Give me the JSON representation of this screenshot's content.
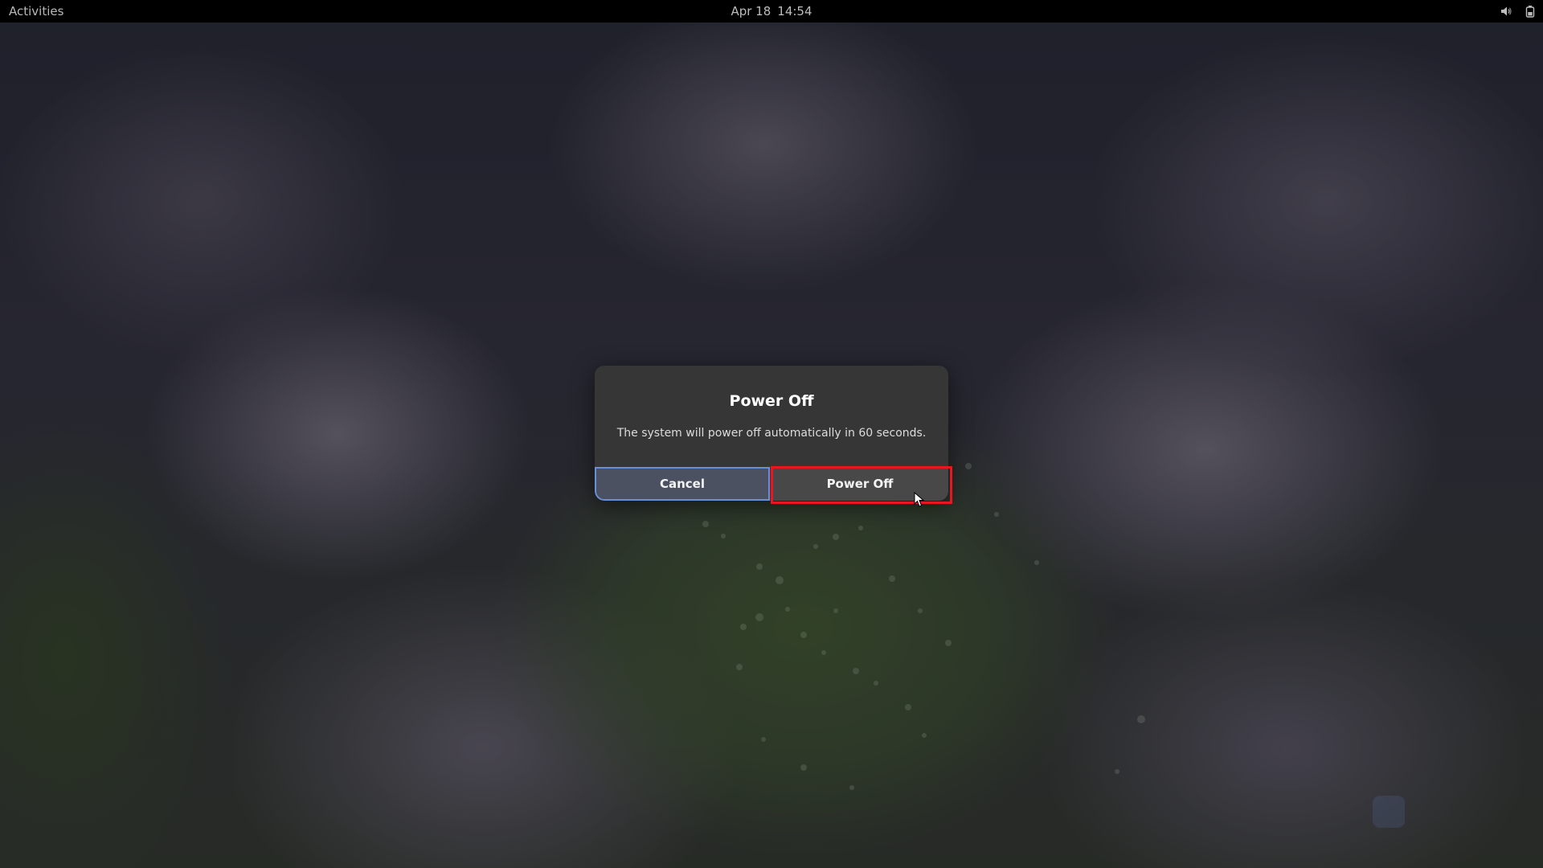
{
  "topbar": {
    "activities_label": "Activities",
    "date": "Apr 18",
    "time": "14:54",
    "icons": [
      "volume-icon",
      "battery-icon"
    ]
  },
  "dialog": {
    "title": "Power Off",
    "message": "The system will power off automatically in 60 seconds.",
    "cancel_label": "Cancel",
    "confirm_label": "Power Off",
    "countdown_seconds": 60
  },
  "colors": {
    "topbar_bg": "#000000",
    "dialog_bg": "#363636",
    "cancel_bg": "#4c5161",
    "focus_ring": "#6b8fd6",
    "highlight": "#e8161e"
  }
}
